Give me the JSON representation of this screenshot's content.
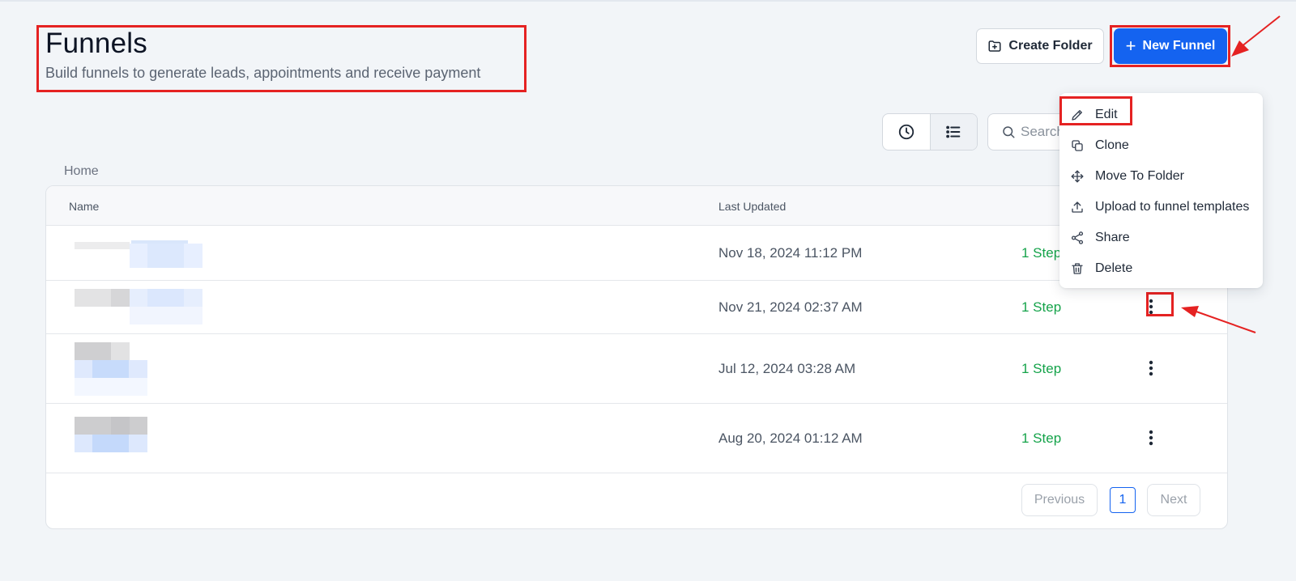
{
  "header": {
    "title": "Funnels",
    "subtitle": "Build funnels to generate leads, appointments and receive payment"
  },
  "actions": {
    "create_folder": "Create Folder",
    "new_funnel": "New Funnel",
    "new_funnel_plus": "+"
  },
  "toolbar": {
    "view_recent_icon": "clock-icon",
    "view_list_icon": "list-icon",
    "search_placeholder": "Search"
  },
  "breadcrumb": "Home",
  "table": {
    "columns": [
      "Name",
      "Last Updated"
    ],
    "rows": [
      {
        "last_updated": "Nov 18, 2024 11:12 PM",
        "steps": "1 Step"
      },
      {
        "last_updated": "Nov 21, 2024 02:37 AM",
        "steps": "1 Step"
      },
      {
        "last_updated": "Jul 12, 2024 03:28 AM",
        "steps": "1 Step"
      },
      {
        "last_updated": "Aug 20, 2024 01:12 AM",
        "steps": "1 Step"
      }
    ]
  },
  "pagination": {
    "previous": "Previous",
    "page": "1",
    "next": "Next"
  },
  "context_menu": {
    "items": [
      {
        "label": "Edit",
        "icon": "pencil-icon"
      },
      {
        "label": "Clone",
        "icon": "copy-icon"
      },
      {
        "label": "Move To Folder",
        "icon": "move-icon"
      },
      {
        "label": "Upload to funnel templates",
        "icon": "upload-icon"
      },
      {
        "label": "Share",
        "icon": "share-icon"
      },
      {
        "label": "Delete",
        "icon": "trash-icon"
      }
    ]
  },
  "colors": {
    "primary": "#1463f0",
    "success": "#15a34a",
    "highlight": "#e52222",
    "background": "#f2f5f8"
  }
}
